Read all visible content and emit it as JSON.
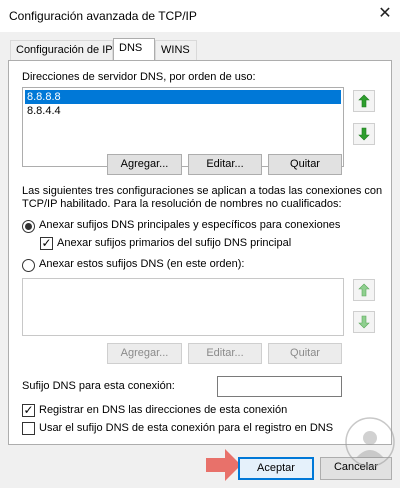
{
  "window": {
    "title": "Configuración avanzada de TCP/IP",
    "close_symbol": "✕"
  },
  "tabs": [
    {
      "label": "Configuración de IP",
      "active": false
    },
    {
      "label": "DNS",
      "active": true
    },
    {
      "label": "WINS",
      "active": false
    }
  ],
  "dns_servers": {
    "label": "Direcciones de servidor DNS, por orden de uso:",
    "items": [
      "8.8.8.8",
      "8.8.4.4"
    ],
    "selected_index": 0,
    "buttons": {
      "add": "Agregar...",
      "edit": "Editar...",
      "remove": "Quitar"
    },
    "arrow_color": "#2e9e2e"
  },
  "info_text": {
    "line1": "Las siguientes tres configuraciones se aplican a todas las conexiones con",
    "line2": "TCP/IP habilitado. Para la resolución de nombres no cualificados:"
  },
  "options": {
    "primary_suffixes": {
      "label": "Anexar sufijos DNS principales y específicos para conexiones",
      "selected": true
    },
    "parent_suffixes": {
      "label": "Anexar sufijos primarios del sufijo DNS principal",
      "checked": true
    },
    "these_suffixes": {
      "label": "Anexar estos sufijos DNS (en este orden):",
      "selected": false
    }
  },
  "suffix_buttons": {
    "add": "Agregar...",
    "edit": "Editar...",
    "remove": "Quitar"
  },
  "connection_suffix": {
    "label": "Sufijo DNS para esta conexión:",
    "value": ""
  },
  "register": {
    "label": "Registrar en DNS las direcciones de esta conexión",
    "checked": true
  },
  "use_suffix": {
    "label": "Usar el sufijo DNS de esta conexión para el registro en DNS",
    "checked": false
  },
  "footer": {
    "accept": "Aceptar",
    "cancel": "Cancelar"
  },
  "colors": {
    "accent": "#0078d7",
    "callout_arrow": "#e8716a"
  }
}
